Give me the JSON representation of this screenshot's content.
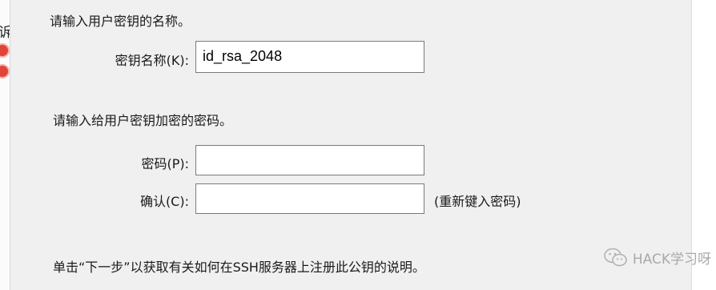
{
  "left_strip": {
    "fragment_text": "诉"
  },
  "section1": {
    "instruction": "请输入用户密钥的名称。",
    "key_name_label": "密钥名称(K):",
    "key_name_value": "id_rsa_2048"
  },
  "section2": {
    "instruction": "请输入给用户密钥加密的密码。",
    "password_label": "密码(P):",
    "password_value": "",
    "confirm_label": "确认(C):",
    "confirm_value": "",
    "confirm_hint": "(重新键入密码)"
  },
  "footer": {
    "text": "单击“下一步”以获取有关如何在SSH服务器上注册此公钥的说明。"
  },
  "watermark": {
    "text": "HACK学习呀",
    "icon": "wechat-icon",
    "color": "#a9a9a9"
  }
}
